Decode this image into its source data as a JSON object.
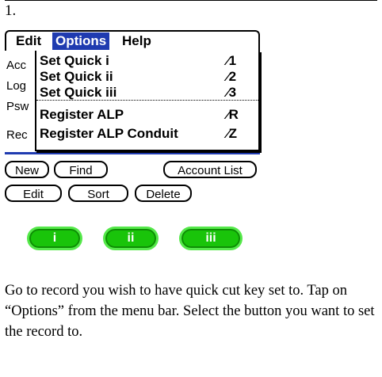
{
  "step_number": "1.",
  "menubar": {
    "items": [
      {
        "label": "Edit",
        "active": false
      },
      {
        "label": "Options",
        "active": true
      },
      {
        "label": "Help",
        "active": false
      }
    ]
  },
  "dropdown": {
    "items": [
      {
        "label": "Set Quick i",
        "shortcut_key": "1"
      },
      {
        "label": "Set Quick ii",
        "shortcut_key": "2"
      },
      {
        "label": "Set Quick iii",
        "shortcut_key": "3"
      },
      {
        "label": "Register ALP",
        "shortcut_key": "R"
      },
      {
        "label": "Register ALP Conduit",
        "shortcut_key": "Z"
      }
    ],
    "shortcut_glyph": "⁄"
  },
  "background_labels": [
    "Acc",
    "Log",
    "Psw",
    "Rec"
  ],
  "buttons_row1": [
    "New",
    "Find",
    "Account List"
  ],
  "buttons_row2": [
    "Edit",
    "Sort",
    "Delete"
  ],
  "quick_buttons": [
    "i",
    "ii",
    "iii"
  ],
  "instructions": "Go to record you wish to have quick cut key set to.  Tap on “Options” from the menu bar. Select the button you want to set the record to.",
  "colors": {
    "highlight": "#1f3bb0",
    "quick_button_fill": "#19c40a"
  }
}
